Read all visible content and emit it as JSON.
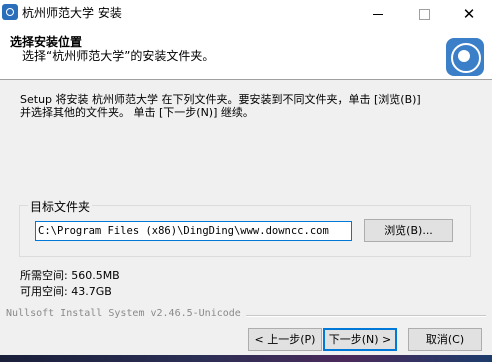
{
  "window": {
    "title": "杭州师范大学 安装",
    "close_glyph": "✕"
  },
  "header": {
    "title": "选择安装位置",
    "subtitle": "选择“杭州师范大学”的安装文件夹。"
  },
  "intro": {
    "line1": "Setup 将安装 杭州师范大学 在下列文件夹。要安装到不同文件夹，单击 [浏览(B)]",
    "line2": "并选择其他的文件夹。 单击 [下一步(N)] 继续。"
  },
  "destination": {
    "legend": "目标文件夹",
    "path": "C:\\Program Files (x86)\\DingDing\\www.downcc.com",
    "browse_label": "浏览(B)..."
  },
  "space": {
    "required": "所需空间: 560.5MB",
    "available": "可用空间: 43.7GB"
  },
  "branding": "Nullsoft Install System v2.46.5-Unicode",
  "buttons": {
    "back": "< 上一步(P)",
    "next": "下一步(N) >",
    "cancel": "取消(C)"
  },
  "colors": {
    "accent": "#0078d7",
    "logo": "#3b7fc8",
    "window_bg": "#f0f0f0"
  },
  "icons": [
    "app-icon",
    "minimize-icon",
    "maximize-icon",
    "close-icon",
    "university-logo"
  ]
}
